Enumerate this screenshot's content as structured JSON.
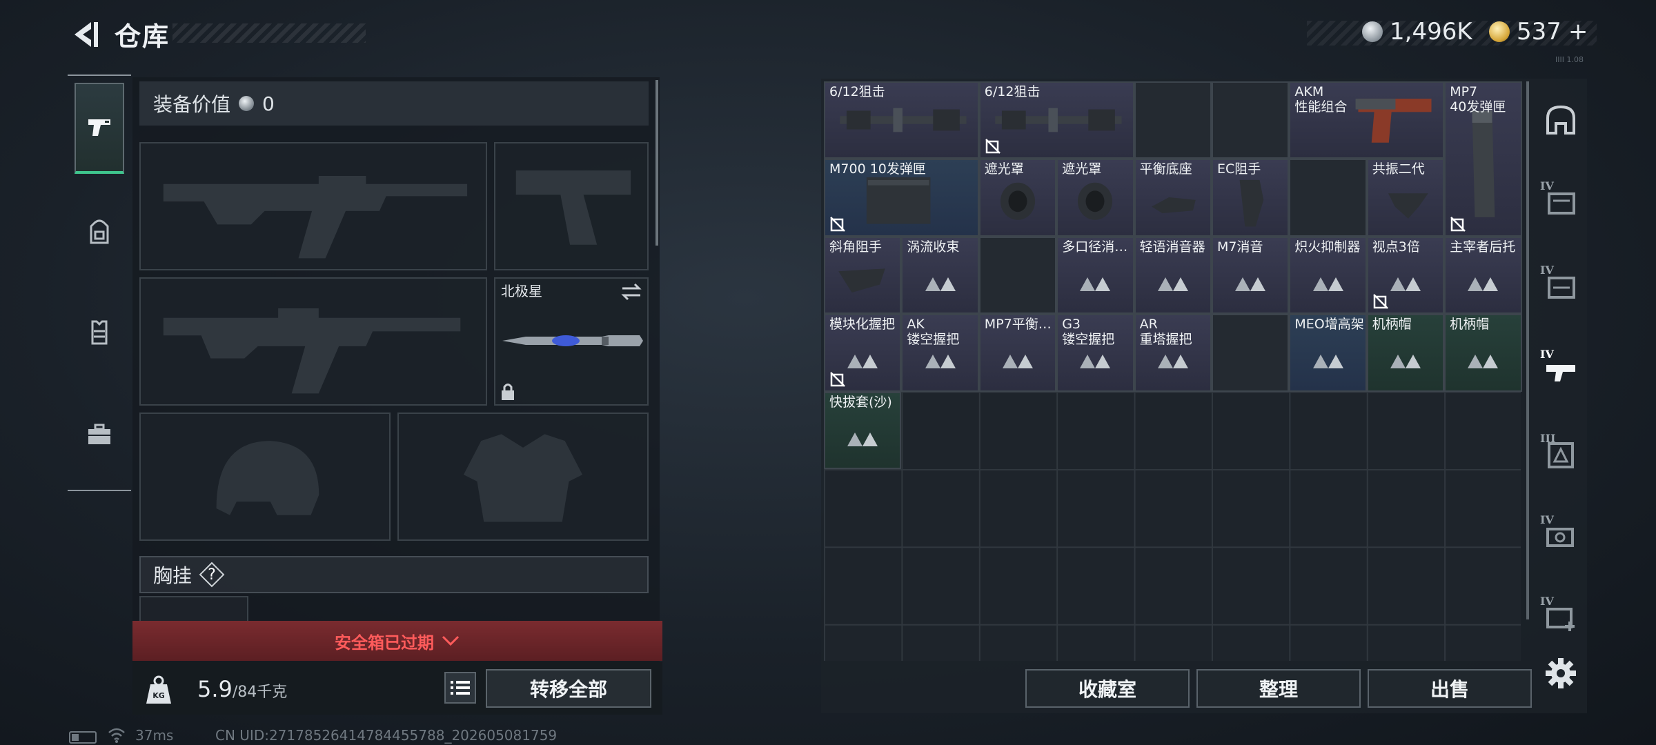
{
  "header": {
    "title": "仓库",
    "currency_silver": "1,496K",
    "currency_gold": "537",
    "gold_add": "+",
    "small_id": "IIII 1.08"
  },
  "left_tabs": [
    {
      "name": "weapons",
      "icon": "pistol-icon",
      "active": true
    },
    {
      "name": "backpack",
      "icon": "backpack-icon",
      "active": false
    },
    {
      "name": "vest",
      "icon": "vest-icon",
      "active": false
    },
    {
      "name": "case",
      "icon": "briefcase-icon",
      "active": false
    }
  ],
  "equipment": {
    "value_label": "装备价值",
    "value_amount": "0",
    "melee_slot_label": "北极星",
    "chest_label": "胸挂",
    "chest_help": "?",
    "safe_banner": "安全箱已过期",
    "weight_current": "5.9",
    "weight_max": "/84千克",
    "transfer_all": "转移全部"
  },
  "stash": {
    "items": [
      {
        "label": "6/12狙击",
        "rarity": "purple",
        "icon": "scope-icon",
        "broken": false
      },
      {
        "label": "6/12狙击",
        "rarity": "purple",
        "icon": "scope-icon",
        "broken": true
      },
      {
        "label": "AKM\n性能组合",
        "rarity": "purple",
        "icon": "akm-grip-icon",
        "broken": false
      },
      {
        "label": "MP7\n40发弹匣",
        "rarity": "purple",
        "icon": "magazine-icon",
        "broken": true
      },
      {
        "label": "M700 10发弹匣",
        "rarity": "blue",
        "icon": "box-magazine-icon",
        "broken": true
      },
      {
        "label": "遮光罩",
        "rarity": "purple",
        "icon": "lens-hood-icon",
        "broken": false
      },
      {
        "label": "遮光罩",
        "rarity": "purple",
        "icon": "lens-hood-icon",
        "broken": false
      },
      {
        "label": "平衡底座",
        "rarity": "purple",
        "icon": "base-icon",
        "broken": false
      },
      {
        "label": "EC阻手",
        "rarity": "purple",
        "icon": "handstop-icon",
        "broken": false
      },
      {
        "label": "共振二代",
        "rarity": "purple",
        "icon": "grip-icon",
        "broken": false
      },
      {
        "label": "斜角阻手",
        "rarity": "purple",
        "icon": "angled-stop-icon",
        "broken": false
      },
      {
        "label": "涡流收束",
        "rarity": "purple",
        "icon": "unknown-item-icon",
        "broken": false
      },
      {
        "label": "多口径消…",
        "rarity": "purple",
        "icon": "unknown-item-icon",
        "broken": false
      },
      {
        "label": "轻语消音器",
        "rarity": "purple",
        "icon": "unknown-item-icon",
        "broken": false
      },
      {
        "label": "M7消音",
        "rarity": "purple",
        "icon": "unknown-item-icon",
        "broken": false
      },
      {
        "label": "炽火抑制器",
        "rarity": "purple",
        "icon": "unknown-item-icon",
        "broken": false
      },
      {
        "label": "视点3倍",
        "rarity": "purple",
        "icon": "unknown-item-icon",
        "broken": true
      },
      {
        "label": "主宰者后托",
        "rarity": "purple",
        "icon": "unknown-item-icon",
        "broken": false
      },
      {
        "label": "模块化握把",
        "rarity": "purple",
        "icon": "unknown-item-icon",
        "broken": true
      },
      {
        "label": "AK\n镂空握把",
        "rarity": "purple",
        "icon": "unknown-item-icon",
        "broken": false
      },
      {
        "label": "MP7平衡…",
        "rarity": "purple",
        "icon": "unknown-item-icon",
        "broken": false
      },
      {
        "label": "G3\n镂空握把",
        "rarity": "purple",
        "icon": "unknown-item-icon",
        "broken": false
      },
      {
        "label": "AR\n重塔握把",
        "rarity": "purple",
        "icon": "unknown-item-icon",
        "broken": false
      },
      {
        "label": "MEO增高架",
        "rarity": "blue",
        "icon": "unknown-item-icon",
        "broken": false
      },
      {
        "label": "机柄帽",
        "rarity": "green",
        "icon": "unknown-item-icon",
        "broken": false
      },
      {
        "label": "机柄帽",
        "rarity": "green",
        "icon": "unknown-item-icon",
        "broken": false
      },
      {
        "label": "快拔套(沙)",
        "rarity": "green",
        "icon": "unknown-item-icon",
        "broken": false
      }
    ],
    "buttons": {
      "collection": "收藏室",
      "sort": "整理",
      "sell": "出售"
    }
  },
  "right_categories": [
    {
      "icon": "helmet-icon",
      "tier": ""
    },
    {
      "icon": "armor-tier-icon",
      "tier": "IV"
    },
    {
      "icon": "armor-tier-icon",
      "tier": "IV"
    },
    {
      "icon": "weapon-tier-icon",
      "tier": "IV"
    },
    {
      "icon": "ammo-tier-icon",
      "tier": "III"
    },
    {
      "icon": "gear-tier-icon",
      "tier": "IV"
    },
    {
      "icon": "medkit-tier-icon",
      "tier": "IV"
    }
  ],
  "status": {
    "ping": "37ms",
    "uid": "CN UID:27178526414784455788_202605081759"
  },
  "colors": {
    "accent_green": "#3fc58d",
    "warning_red": "#ff5b5b",
    "purple_rarity": "#3a3c52",
    "blue_rarity": "#2d3f55",
    "green_rarity": "#27403a"
  }
}
